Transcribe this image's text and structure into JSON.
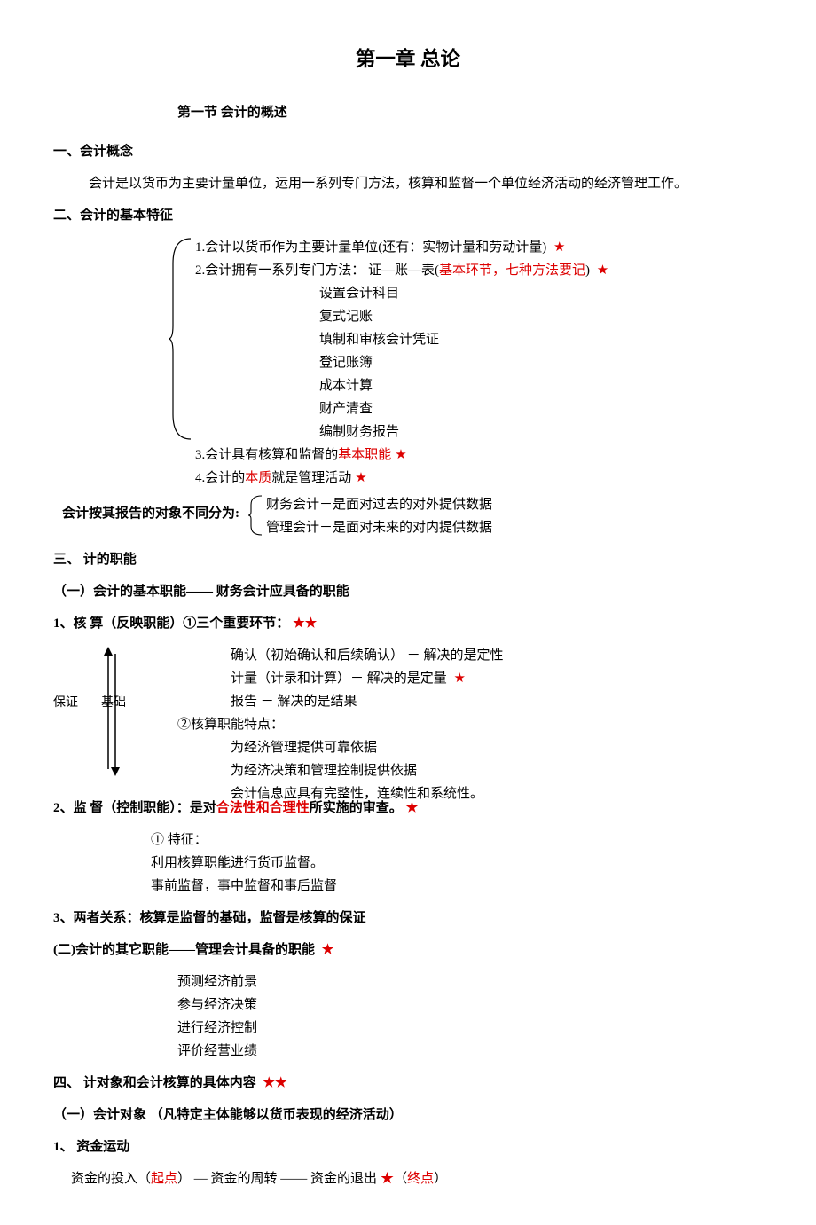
{
  "chapter": "第一章    总论",
  "section1": "第一节    会计的概述",
  "h1": "一、会计概念",
  "p1": "会计是以货币为主要计量单位，运用一系列专门方法，核算和监督一个单位经济活动的经济管理工作。",
  "h2": "二、会计的基本特征",
  "b1": "1.会计以货币作为主要计量单位(还有：实物计量和劳动计量)  ",
  "b2a": "2.会计拥有一系列专门方法：  证—账—表(",
  "b2b": "基本环节，七种方法要记",
  "b2c": ")    ",
  "m1": "设置会计科目",
  "m2": "复式记账",
  "m3": "填制和审核会计凭证",
  "m4": "登记账簿",
  "m5": "成本计算",
  "m6": "财产清查",
  "m7": "编制财务报告",
  "b3a": "3.会计具有核算和监督的",
  "b3b": "基本职能",
  "b4a": "4.会计的",
  "b4b": "本质",
  "b4c": "就是管理活动",
  "split_label": "会计按其报告的对象不同分为:",
  "s1": "财务会计－是面对过去的对外提供数据",
  "s2": "管理会计－是面对未来的对内提供数据",
  "h3": "三、    计的职能",
  "h3_1": "（一）会计的基本职能——  财务会计应具备的职能",
  "hs1": "1、核    算（反映职能）①三个重要环节：",
  "a1": "确认（初始确认和后续确认） －  解决的是定性",
  "a2a": "计量（计录和计算）－  解决的是定量   ",
  "a3": "报告  －  解决的是结果",
  "a_sub": "②核算职能特点：",
  "a4": "为经济管理提供可靠依据",
  "a5": "为经济决策和管理控制提供依据",
  "a6": "会计信息应具有完整性，连续性和系统性。",
  "lbl_bz": "保证",
  "lbl_jc": "基础",
  "hs2a": "2、监    督（控制职能）：是对",
  "hs2b": "合法性和合理性",
  "hs2c": "所实施的审查。",
  "c1": "①  特征：",
  "c2": "利用核算职能进行货币监督。",
  "c3": "事前监督，事中监督和事后监督",
  "hs3": "3、两者关系：核算是监督的基础，监督是核算的保证",
  "h3_2": "(二)会计的其它职能——管理会计具备的职能    ",
  "o1": "预测经济前景",
  "o2": "参与经济决策",
  "o3": "进行经济控制",
  "o4": "评价经营业绩",
  "h4": "四、    计对象和会计核算的具体内容  ",
  "h4_1": "（一）会计对象   （凡特定主体能够以货币表现的经济活动）",
  "h4_2": "1、 资金运动",
  "f1a": "资金的投入（",
  "f1b": "起点",
  "f1c": "）    —    资金的周转      ——    资金的退出",
  "f1d": "（",
  "f1e": "终点",
  "f1f": "）"
}
